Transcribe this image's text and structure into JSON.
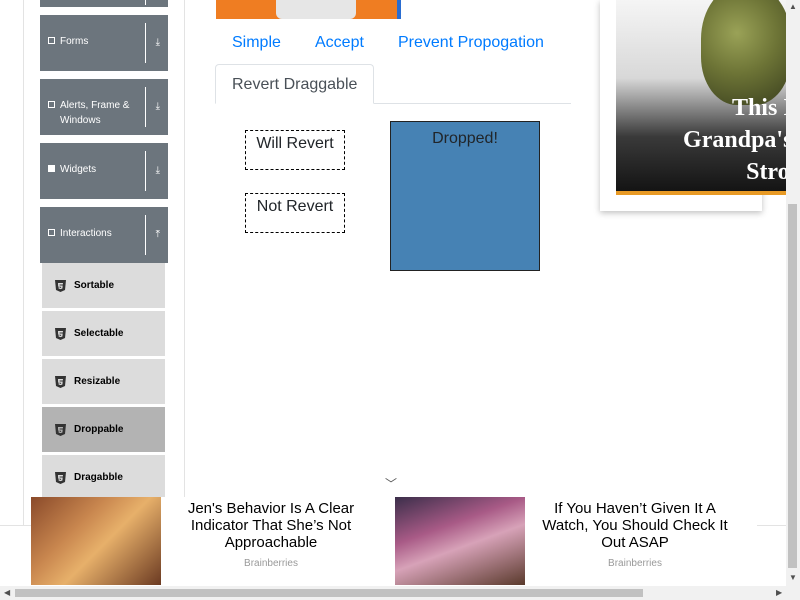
{
  "sidebar": {
    "groups": [
      {
        "label": "Forms",
        "arrow": "⤓"
      },
      {
        "label": "Alerts, Frame & Windows",
        "arrow": "⤓"
      },
      {
        "label": "Widgets",
        "arrow": "⤓"
      },
      {
        "label": "Interactions",
        "arrow": "⤒"
      }
    ],
    "items": [
      {
        "label": "Sortable"
      },
      {
        "label": "Selectable"
      },
      {
        "label": "Resizable"
      },
      {
        "label": "Droppable"
      },
      {
        "label": "Dragabble"
      }
    ]
  },
  "tabs": {
    "simple": "Simple",
    "accept": "Accept",
    "prevent": "Prevent Propogation",
    "revert": "Revert Draggable"
  },
  "draggables": {
    "will_revert": "Will Revert",
    "not_revert": "Not Revert"
  },
  "drop_zone": {
    "text": "Dropped!",
    "color": "#4682b4"
  },
  "ad_right": {
    "line1": "This Isn't",
    "line2": "Grandpa's The",
    "line3": "Strong"
  },
  "bottom_ads": [
    {
      "title": "Jen's Behavior Is A Clear Indicator That She’s Not Approachable",
      "source": "Brainberries"
    },
    {
      "title": "If You Haven’t Given It A Watch, You Should Check It Out ASAP",
      "source": "Brainberries"
    }
  ],
  "colors": {
    "accent": "#007bff",
    "sidebar_group": "#6c757d",
    "sidebar_item": "#dcdcdc",
    "sidebar_item_active": "#b3b3b3"
  }
}
